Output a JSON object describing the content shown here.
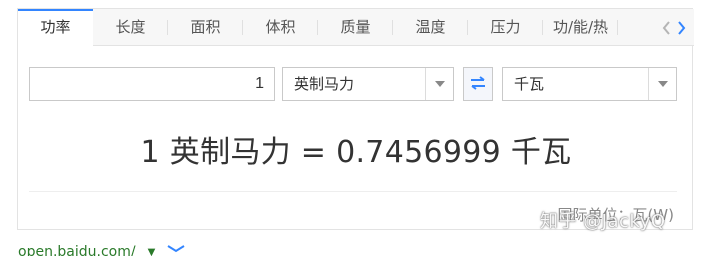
{
  "tabs": [
    {
      "label": "功率",
      "active": true
    },
    {
      "label": "长度",
      "active": false
    },
    {
      "label": "面积",
      "active": false
    },
    {
      "label": "体积",
      "active": false
    },
    {
      "label": "质量",
      "active": false
    },
    {
      "label": "温度",
      "active": false
    },
    {
      "label": "压力",
      "active": false
    },
    {
      "label": "功/能/热",
      "active": false
    }
  ],
  "tab_nav": {
    "prev_icon": "chevron-left-icon",
    "next_icon": "chevron-right-icon"
  },
  "converter": {
    "input_value": "1",
    "from_unit": "英制马力",
    "to_unit": "千瓦",
    "swap_icon": "swap-arrows-icon",
    "swap_color": "#3385ff"
  },
  "result_text": "1 英制马力 = 0.7456999 千瓦",
  "intl_unit_text": "国际单位：瓦(W)",
  "watermark_text": "知乎 @JackyQ",
  "footer": {
    "url": "open.baidu.com/"
  },
  "colors": {
    "accent": "#3385ff",
    "url_green": "#2a7a2a"
  }
}
